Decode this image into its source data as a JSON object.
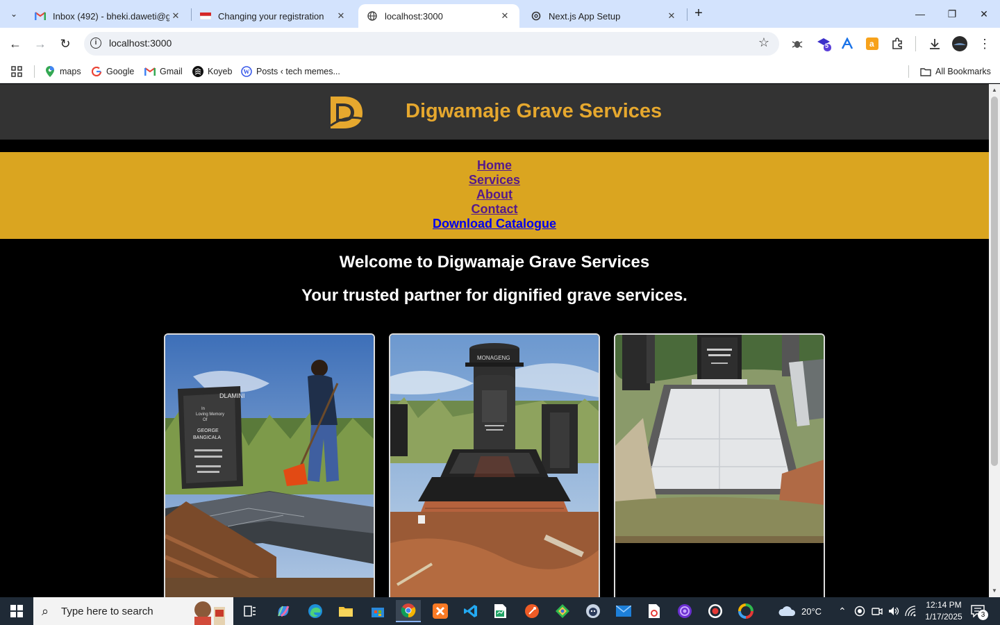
{
  "browser": {
    "tabs": [
      {
        "title": "Inbox (492) - bheki.daweti@gm",
        "icon": "gmail-icon",
        "active": false
      },
      {
        "title": "Changing your registration",
        "icon": "flag-icon",
        "active": false
      },
      {
        "title": "localhost:3000",
        "icon": "globe-icon",
        "active": true
      },
      {
        "title": "Next.js App Setup",
        "icon": "openai-icon",
        "active": false
      }
    ],
    "url": "localhost:3000",
    "bookmarks": [
      {
        "label": "maps",
        "icon": "google-maps-icon"
      },
      {
        "label": "Google",
        "icon": "google-icon"
      },
      {
        "label": "Gmail",
        "icon": "gmail-icon"
      },
      {
        "label": "Koyeb",
        "icon": "koyeb-icon"
      },
      {
        "label": "Posts ‹ tech memes...",
        "icon": "wordpress-icon"
      }
    ],
    "all_bookmarks": "All Bookmarks",
    "extension_badge": "5"
  },
  "site": {
    "brand": "Digwamaje Grave Services",
    "nav": [
      "Home",
      "Services",
      "About",
      "Contact",
      "Download Catalogue"
    ],
    "welcome": "Welcome to Digwamaje Grave Services",
    "tagline": "Your trusted partner for dignified grave services.",
    "headstone_1": {
      "name": "DLAMINI",
      "line1": "In",
      "line2": "Loving Memory",
      "line3": "Of",
      "line4": "GEORGE",
      "line5": "BANGICALA"
    },
    "headstone_2": {
      "name": "MONAGENG"
    },
    "colors": {
      "header_bg": "#333333",
      "brand": "#e6a82e",
      "nav_bg": "#daa520",
      "page_bg": "#000000"
    }
  },
  "taskbar": {
    "search_placeholder": "Type here to search",
    "weather": "20°C",
    "time": "12:14 PM",
    "date": "1/17/2025",
    "notifications": "3"
  }
}
